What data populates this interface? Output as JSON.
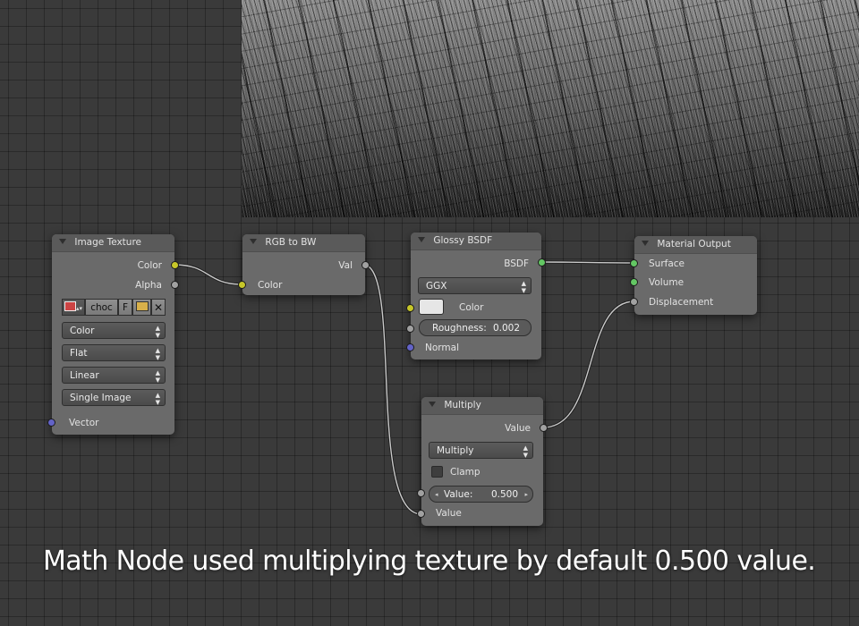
{
  "nodes": {
    "image_texture": {
      "title": "Image Texture",
      "outputs": [
        "Color",
        "Alpha"
      ],
      "image_name": "choc",
      "fake_user_label": "F",
      "color_space": "Color",
      "projection": "Flat",
      "interpolation": "Linear",
      "source": "Single Image",
      "inputs": [
        "Vector"
      ]
    },
    "rgb_to_bw": {
      "title": "RGB to BW",
      "output": "Val",
      "input": "Color"
    },
    "glossy_bsdf": {
      "title": "Glossy BSDF",
      "output": "BSDF",
      "distribution": "GGX",
      "color_label": "Color",
      "roughness_label": "Roughness:",
      "roughness_value": "0.002",
      "normal_label": "Normal"
    },
    "material_output": {
      "title": "Material Output",
      "inputs": [
        "Surface",
        "Volume",
        "Displacement"
      ]
    },
    "multiply": {
      "title": "Multiply",
      "output": "Value",
      "operation": "Multiply",
      "clamp_label": "Clamp",
      "value_label": "Value:",
      "value": "0.500",
      "input_label": "Value"
    }
  },
  "colors": {
    "socket_color": "#c7c729",
    "socket_float": "#a1a1a1",
    "socket_vector": "#6363c7",
    "socket_shader": "#63c763"
  },
  "caption": "Math Node used multiplying texture by default 0.500 value."
}
